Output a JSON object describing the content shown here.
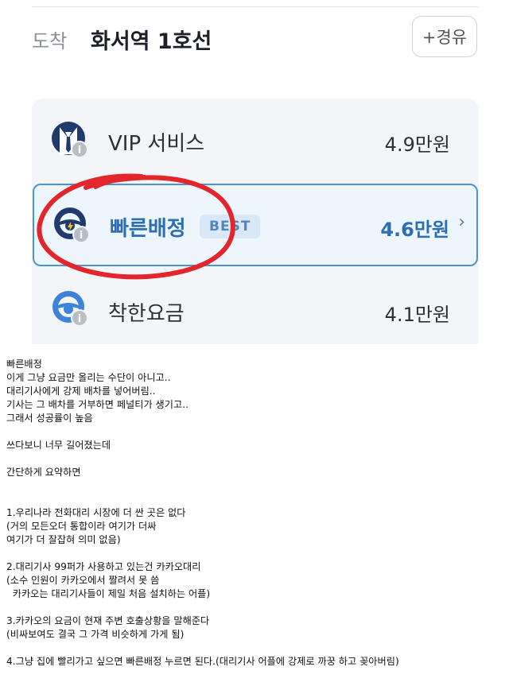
{
  "destination": {
    "label": "도착",
    "value": "화서역 1호선",
    "waypoint_button": "+경유"
  },
  "options": [
    {
      "name": "VIP 서비스",
      "price": "4.9만원",
      "icon": "vip-suit-icon",
      "selected": false
    },
    {
      "name": "빠른배정",
      "badge": "BEST",
      "price": "4.6만원",
      "icon": "steering-wheel-lightning-icon",
      "selected": true
    },
    {
      "name": "착한요금",
      "price": "4.1만원",
      "icon": "steering-wheel-icon",
      "selected": false
    }
  ],
  "colors": {
    "accent": "#2a6fb6",
    "selected_border": "#4d94cf",
    "annotation_red": "#e2262b"
  },
  "post": {
    "lines": [
      "빠른배정",
      "이게 그냥 요금만 올리는 수단이 아니고..",
      "대리기사에게 강제 배차를 넣어버림..",
      "기사는 그 배차를 거부하면 페널티가 생기고..",
      "그래서 성공률이 높음",
      "",
      "쓰다보니 너무 길어졌는데",
      "",
      "간단하게 요약하면",
      "",
      "",
      "1.우리나라 전화대리 시장에 더 싼 곳은 없다",
      "(거의 모든오더 통합이라 여기가 더싸",
      "여기가 더 잘잡혀 의미 없음)",
      "",
      "2.대리기사 99퍼가 사용하고 있는건 카카오대리",
      "(소수 인원이 카카오에서 짤려서 못 씀",
      "  카카오는 대리기사들이 제일 처음 설치하는 어플)",
      "",
      "3.카카오의 요금이 현재 주변 호출상황을 말해준다",
      "(비싸보여도 결국 그 가격 비슷하게 가게 됨)",
      "",
      "4.그냥 집에 빨리가고 싶으면 빠른배정 누르면 된다.(대리기사 어플에 강제로 까꿍 하고 꽂아버림)"
    ]
  }
}
